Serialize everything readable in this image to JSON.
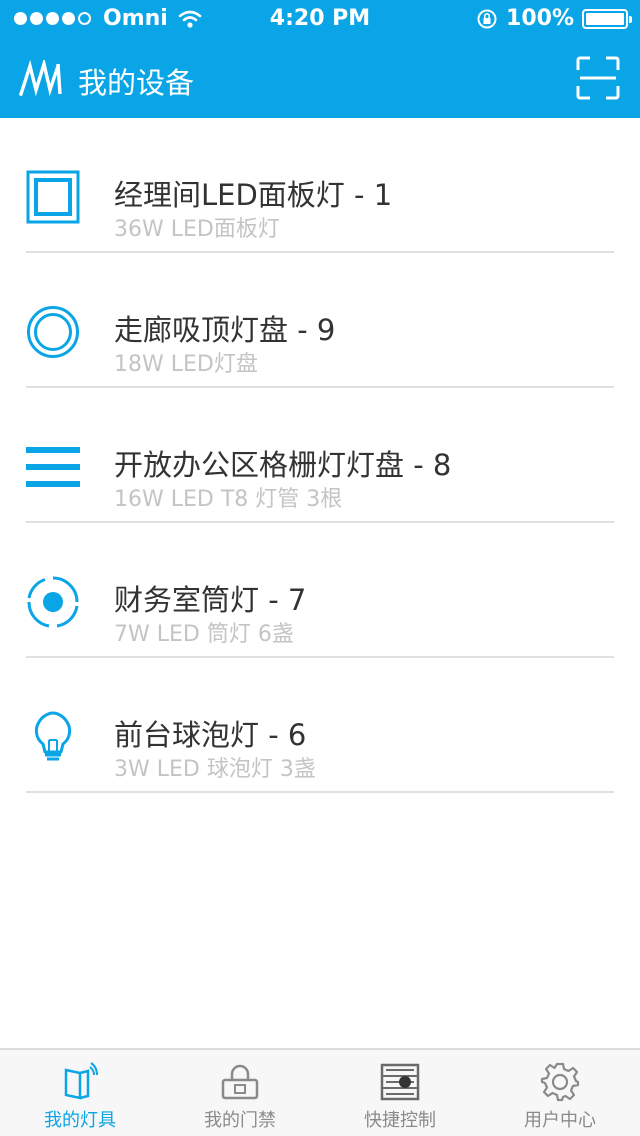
{
  "status_bar": {
    "carrier": "Omni",
    "time": "4:20 PM",
    "battery": "100%"
  },
  "nav": {
    "title": "我的设备",
    "icons": {
      "logo": "app-logo-icon",
      "scan": "scan-icon"
    }
  },
  "devices": [
    {
      "title": "经理间LED面板灯 - 1",
      "subtitle": "36W LED面板灯",
      "icon": "panel-light-icon"
    },
    {
      "title": "走廊吸顶灯盘 - 9",
      "subtitle": "18W LED灯盘",
      "icon": "ceiling-light-icon"
    },
    {
      "title": "开放办公区格栅灯灯盘 - 8",
      "subtitle": "16W LED T8 灯管 3根",
      "icon": "grille-light-icon"
    },
    {
      "title": "财务室筒灯 - 7",
      "subtitle": "7W LED 筒灯 6盏",
      "icon": "downlight-icon"
    },
    {
      "title": "前台球泡灯 - 6",
      "subtitle": "3W LED 球泡灯 3盏",
      "icon": "bulb-icon"
    }
  ],
  "tabs": [
    {
      "label": "我的灯具",
      "icon": "light-fixture-icon",
      "active": true
    },
    {
      "label": "我的门禁",
      "icon": "door-lock-icon",
      "active": false
    },
    {
      "label": "快捷控制",
      "icon": "quick-control-icon",
      "active": false
    },
    {
      "label": "用户中心",
      "icon": "gear-icon",
      "active": false
    }
  ],
  "colors": {
    "accent": "#0aa5e6",
    "divider": "#e0e0e0",
    "subtitle": "#c4c4c4",
    "tab_inactive": "#8a8a8a"
  }
}
